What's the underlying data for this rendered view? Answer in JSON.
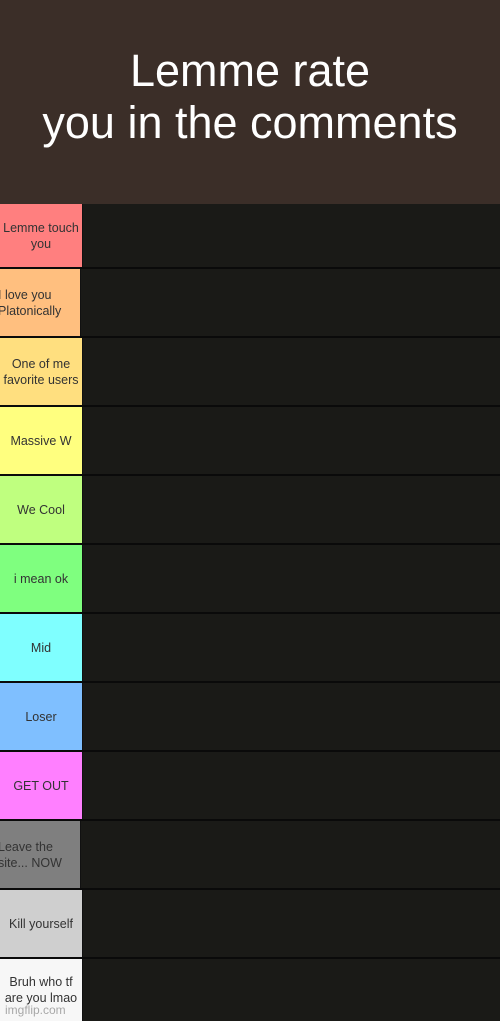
{
  "header": {
    "title": "Lemme rate\nyou in the comments",
    "background": "#3b2e28"
  },
  "tiers": [
    {
      "label": "Lemme touch\nyou",
      "color": "#ff7f7f"
    },
    {
      "label": "I love you\nPlatonically",
      "color": "#ffbf7f"
    },
    {
      "label": "One of me\nfavorite users",
      "color": "#ffdf7f"
    },
    {
      "label": "Massive W",
      "color": "#ffff7f"
    },
    {
      "label": "We Cool",
      "color": "#bfff7f"
    },
    {
      "label": "i mean ok",
      "color": "#7fff7f"
    },
    {
      "label": "Mid",
      "color": "#7fffff"
    },
    {
      "label": "Loser",
      "color": "#7fbfff"
    },
    {
      "label": "GET OUT",
      "color": "#ff7fff"
    },
    {
      "label": "Leave the\nsite... NOW",
      "color": "#7f7f7f"
    },
    {
      "label": "Kill yourself",
      "color": "#cfcfcf"
    },
    {
      "label": "Bruh who tf\nare you lmao",
      "color": "#f7f7f7"
    }
  ],
  "watermark": "imgflip.com"
}
